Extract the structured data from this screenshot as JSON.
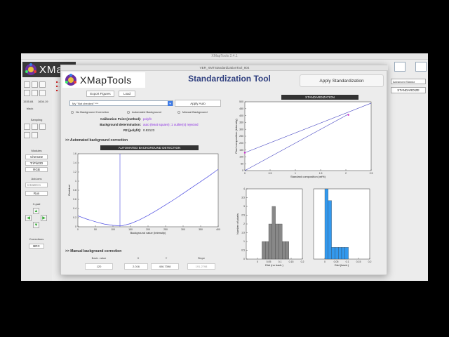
{
  "bg_window": {
    "title": "XMapTools 2.4.1",
    "logo_text": "XMa",
    "tools": {
      "value_left": "1535.84",
      "value_right": "1604.19",
      "black_label": "black"
    },
    "sampling_label": "Sampling",
    "modules_label": "Modules",
    "modules": [
      "Chem2D",
      "TriPlot3D",
      "RGB"
    ],
    "addons_label": "Add-ons",
    "addons_dropdown": "IntraBCm",
    "addons_button": "Run",
    "xpad_label": "X-pad",
    "corrections_label": "Corrections",
    "corrections_button": "BRC",
    "advanced_dropdown": "Advanced Standz",
    "standardize_button": "STANDARDIZE"
  },
  "dialog": {
    "title": "VER_XMTStandardizationTool_804",
    "logo_text": "XMapTools",
    "heading": "Standardization Tool",
    "apply_button": "Apply Standardization",
    "tabs": [
      "Export Figures",
      "Load"
    ],
    "mode_dropdown": "My   \"Not checked\"   ***",
    "apply_auto_button": "Apply Auto",
    "radios": [
      "No Background Correction",
      "Automated Background",
      "Manual Background"
    ],
    "calibration_point_label": "Calibration Point (method):",
    "calibration_point_value": "polyfit",
    "background_label": "Background determination:",
    "background_value": "auto (least square); 1 outlier(s) rejected",
    "r2_label": "R2 (polyfit):",
    "r2_value": "0.82123",
    "auto_section": ">> Automated background correction",
    "manual_section": ">> Manual background correction",
    "manual_labels": [
      "Back. value",
      "X",
      "Y",
      "Slope"
    ],
    "manual_values": [
      "120",
      "2.016",
      "406.7398",
      "191.2798"
    ]
  },
  "chart_data": [
    {
      "type": "line",
      "title": "AUTOMATED BACKGROUND DETECTION",
      "xlabel": "Background value (Intensity)",
      "ylabel": "Residual",
      "xlim": [
        0,
        400
      ],
      "ylim": [
        0,
        1.6
      ],
      "xticks": [
        0,
        50,
        100,
        150,
        200,
        250,
        300,
        350,
        400
      ],
      "yticks": [
        0,
        0.2,
        0.4,
        0.6,
        0.8,
        1,
        1.2,
        1.4,
        1.6
      ],
      "x": [
        0,
        25,
        50,
        75,
        100,
        125,
        150,
        175,
        200,
        225,
        250,
        275,
        300,
        325,
        350,
        375,
        400
      ],
      "y": [
        0.24,
        0.17,
        0.11,
        0.06,
        0.03,
        0.02,
        0.07,
        0.15,
        0.25,
        0.36,
        0.48,
        0.6,
        0.73,
        0.86,
        0.99,
        1.12,
        1.26
      ],
      "vline": 120
    },
    {
      "type": "scatter",
      "title": "STANDARDIZATION",
      "xlabel": "Standard composition (wt%)",
      "ylabel": "Pixel composition (intensity)",
      "xlim": [
        0,
        2.5
      ],
      "ylim": [
        0,
        500
      ],
      "xticks": [
        0,
        0.5,
        1,
        1.5,
        2,
        2.5
      ],
      "yticks": [
        0,
        50,
        100,
        150,
        200,
        250,
        300,
        350,
        400,
        450,
        500
      ],
      "fit_line": [
        [
          0,
          130
        ],
        [
          2.5,
          490
        ]
      ],
      "back_line": [
        [
          0,
          0
        ],
        [
          2.05,
          410
        ]
      ],
      "points": [
        [
          0,
          130
        ],
        [
          2.05,
          405
        ]
      ]
    },
    {
      "type": "bar",
      "xlabel": "Dist (no back.)",
      "ylabel": "Number of pixels",
      "xlim": [
        -0.05,
        0.2
      ],
      "ylim": [
        0,
        4
      ],
      "xticks": [
        0,
        0.05,
        0.1,
        0.15,
        0.2
      ],
      "yticks": [
        0,
        0.5,
        1,
        1.5,
        2,
        2.5,
        3,
        3.5,
        4
      ],
      "bins": [
        0.02,
        0.035,
        0.05,
        0.065,
        0.08,
        0.095,
        0.11,
        0.125
      ],
      "values": [
        1,
        1,
        2,
        3,
        2,
        2,
        1,
        1
      ],
      "color": "#888888"
    },
    {
      "type": "bar",
      "xlabel": "Dist (back.)",
      "ylabel": "",
      "xlim": [
        -0.05,
        0.2
      ],
      "ylim": [
        0,
        6
      ],
      "xticks": [
        0,
        0.05,
        0.1,
        0.15,
        0.2
      ],
      "yticks": [],
      "bins": [
        0.0,
        0.015,
        0.03,
        0.045,
        0.06,
        0.075,
        0.09
      ],
      "values": [
        6,
        5,
        1,
        1,
        1,
        1,
        1
      ],
      "color": "#3399ee"
    }
  ]
}
